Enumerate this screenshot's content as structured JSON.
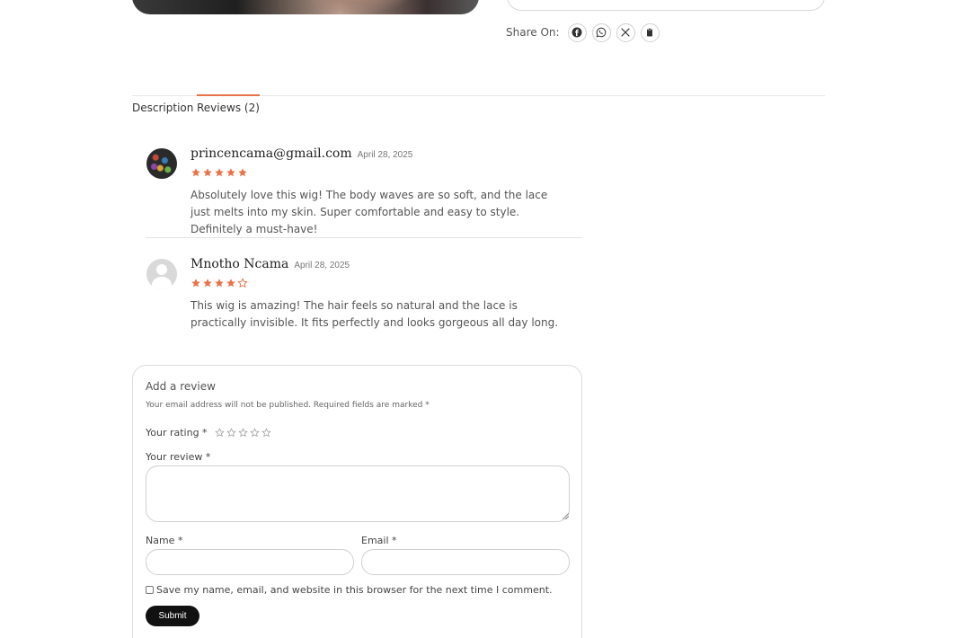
{
  "share": {
    "label": "Share On:",
    "icons": [
      "facebook-icon",
      "whatsapp-icon",
      "x-icon",
      "clipboard-icon"
    ]
  },
  "tabs": [
    {
      "label": "Description",
      "active": false
    },
    {
      "label": "Reviews (2)",
      "active": true
    }
  ],
  "reviews": [
    {
      "author": "princencama@gmail.com",
      "date": "April 28, 2025",
      "rating": 5,
      "text": "Absolutely love this wig! The body waves are so soft, and the lace just melts into my skin. Super comfortable and easy to style. Definitely a must-have!"
    },
    {
      "author": "Mnotho Ncama",
      "date": "April 28, 2025",
      "rating": 4,
      "text": "This wig is amazing! The hair feels so natural and the lace is practically invisible. It fits perfectly and looks gorgeous all day long."
    }
  ],
  "form": {
    "title": "Add a review",
    "notes": "Your email address will not be published. Required fields are marked *",
    "rating_label": "Your rating *",
    "review_label": "Your review *",
    "name_label": "Name *",
    "email_label": "Email *",
    "save_label": "Save my name, email, and website in this browser for the next time I comment.",
    "submit_label": "Submit"
  },
  "colors": {
    "accent": "#e8734a",
    "star": "#e8734a",
    "button": "#111111"
  }
}
